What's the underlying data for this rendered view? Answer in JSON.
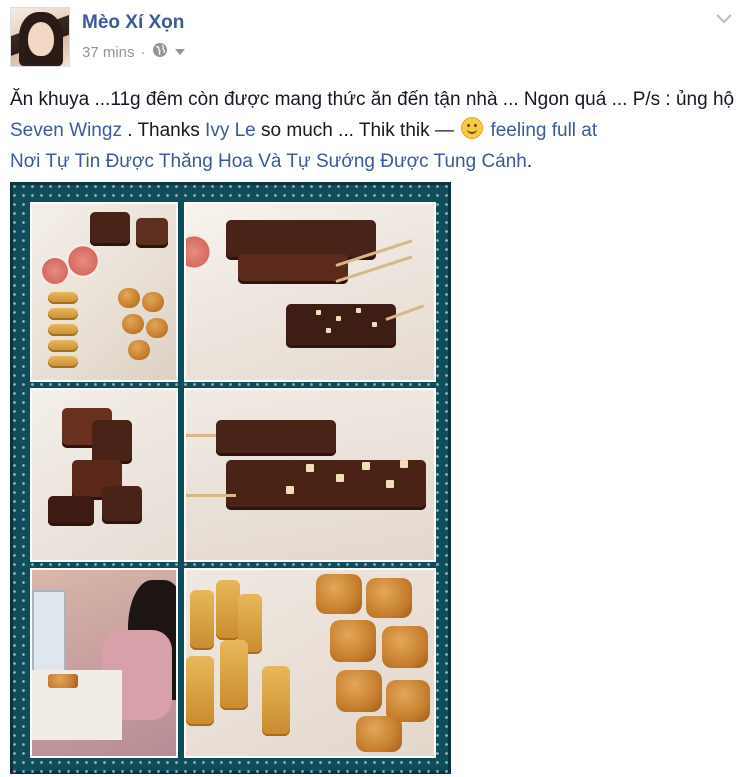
{
  "post": {
    "author": "Mèo Xí Xọn",
    "time": "37 mins",
    "separator": "·",
    "privacy_icon": "globe-icon",
    "menu_icon": "chevron-down-icon"
  },
  "content": {
    "part1": "Ăn khuya ...11g đêm còn được mang thức ăn đến tận nhà ... Ngon quá ... P/s : ủng hộ ",
    "link_page": "Seven Wingz",
    "part2": " . Thanks ",
    "link_friend": "Ivy Le",
    "part3": " so much ... Thik thik — ",
    "emoji": "smile-emoji",
    "feeling": " feeling full at ",
    "link_place": "Nơi Tự Tin Được Thăng Hoa Và Tự Sướng Được Tung Cánh",
    "part4": "."
  },
  "colors": {
    "link": "#3b5998",
    "meta": "#90949c",
    "frame": "#0f4d5a"
  }
}
